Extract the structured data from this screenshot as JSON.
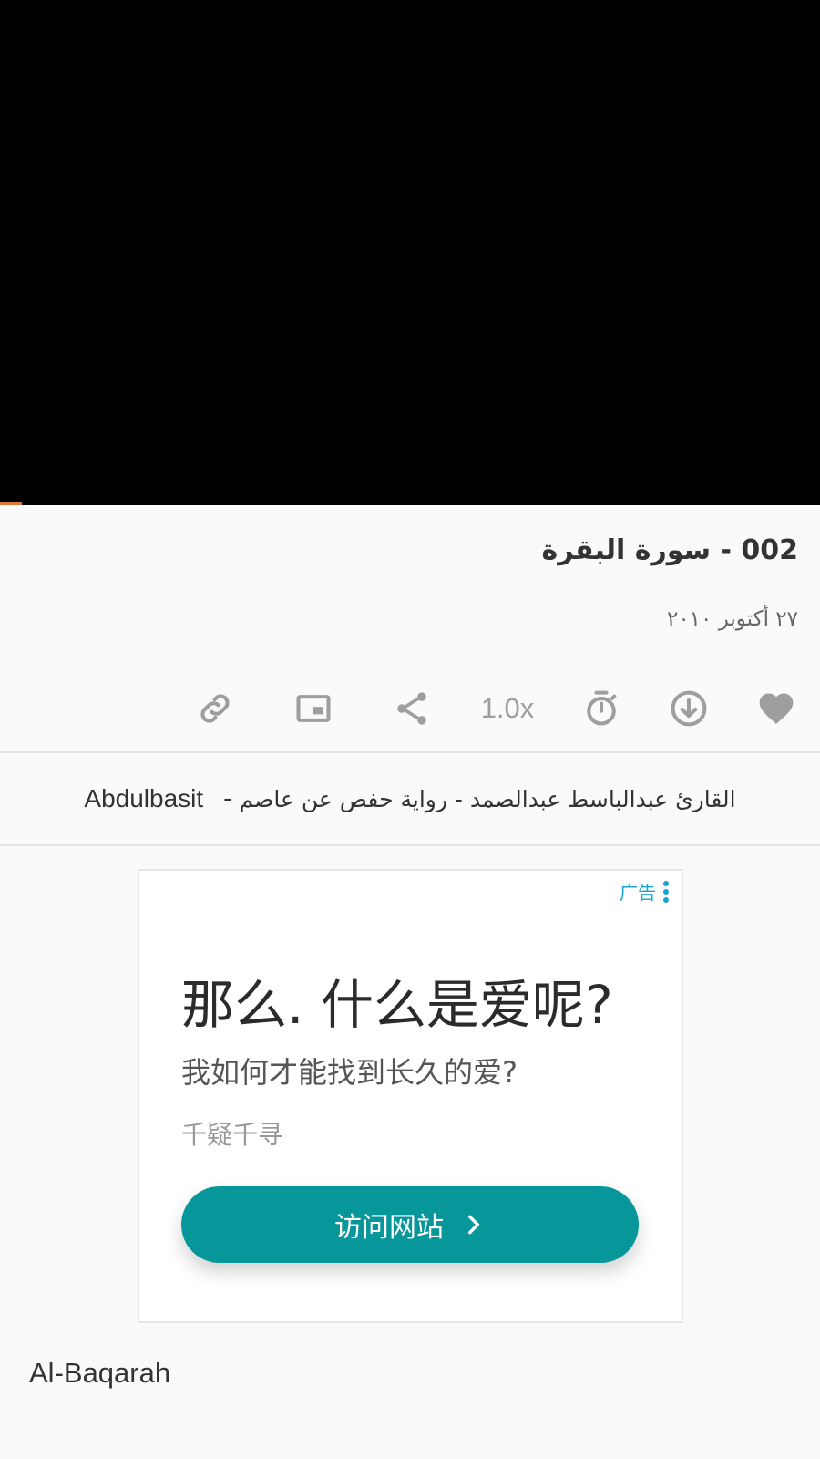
{
  "player": {
    "video_area": "video-player"
  },
  "track": {
    "title": "002 - سورة البقرة",
    "date": "٢٧ أكتوبر ٢٠١٠"
  },
  "actions": {
    "items": [
      {
        "name": "link-button",
        "icon": "link-icon"
      },
      {
        "name": "pip-button",
        "icon": "picture-in-picture-icon"
      },
      {
        "name": "share-button",
        "icon": "share-icon"
      },
      {
        "name": "speed-button",
        "label": "1.0x"
      },
      {
        "name": "timer-button",
        "icon": "timer-icon"
      },
      {
        "name": "download-button",
        "icon": "download-icon"
      },
      {
        "name": "favorite-button",
        "icon": "heart-icon"
      }
    ],
    "speed_label": "1.0x"
  },
  "reciter": {
    "arabic": "القارئ عبدالباسط عبدالصمد - رواية حفص عن عاصم",
    "separator": "-",
    "english": "Abdulbasit"
  },
  "ad": {
    "label": "广告",
    "headline": "那么. 什么是爱呢?",
    "subtitle": "我如何才能找到长久的爱?",
    "brand": "千疑千寻",
    "button_label": "访问网站",
    "button_color": "#079699",
    "label_color": "#1aa3d4"
  },
  "footer": {
    "name": "Al-Baqarah"
  },
  "colors": {
    "icon_gray": "#9e9e9e",
    "accent_progress": "#e07a3a"
  }
}
